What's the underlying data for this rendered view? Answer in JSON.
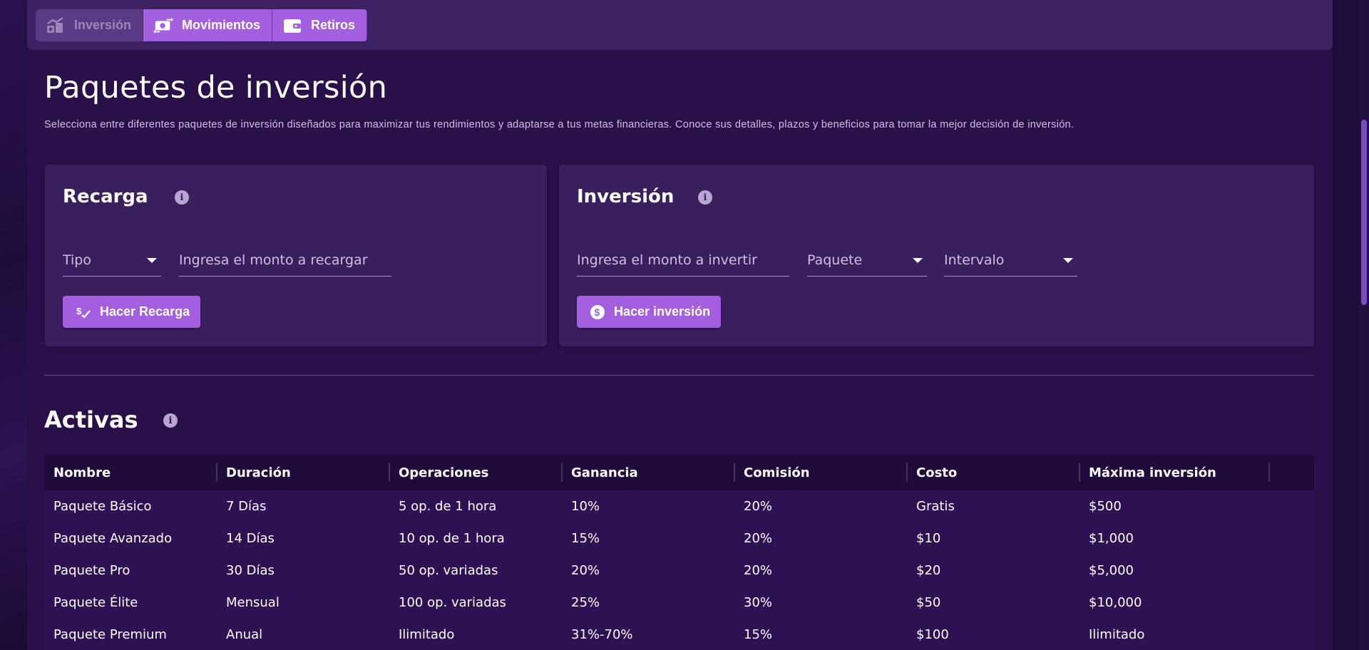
{
  "nav": {
    "tabs": [
      {
        "label": "Inversión",
        "icon": "growth-chart-icon",
        "state": "disabled"
      },
      {
        "label": "Movimientos",
        "icon": "money-transfer-icon",
        "state": "active"
      },
      {
        "label": "Retiros",
        "icon": "wallet-icon",
        "state": "active"
      }
    ]
  },
  "page": {
    "title": "Paquetes de inversión",
    "description": "Selecciona entre diferentes paquetes de inversión diseñados para maximizar tus rendimientos y adaptarse a tus metas financieras. Conoce sus detalles, plazos y beneficios para tomar la mejor decisión de inversión."
  },
  "recarga": {
    "title": "Recarga",
    "type_field": "Tipo",
    "amount_field": "Ingresa el monto a recargar",
    "button": "Hacer Recarga"
  },
  "inversion": {
    "title": "Inversión",
    "amount_field": "Ingresa el monto a invertir",
    "package_field": "Paquete",
    "interval_field": "Intervalo",
    "button": "Hacer inversión"
  },
  "activas": {
    "title": "Activas",
    "columns": [
      "Nombre",
      "Duración",
      "Operaciones",
      "Ganancia",
      "Comisión",
      "Costo",
      "Máxima inversión"
    ],
    "rows": [
      [
        "Paquete Básico",
        "7 Días",
        "5 op. de 1 hora",
        "10%",
        "20%",
        "Gratis",
        "$500"
      ],
      [
        "Paquete Avanzado",
        "14 Días",
        "10 op. de 1 hora",
        "15%",
        "20%",
        "$10",
        "$1,000"
      ],
      [
        "Paquete Pro",
        "30 Días",
        "50 op. variadas",
        "20%",
        "20%",
        "$20",
        "$5,000"
      ],
      [
        "Paquete Élite",
        "Mensual",
        "100 op. variadas",
        "25%",
        "30%",
        "$50",
        "$10,000"
      ],
      [
        "Paquete Premium",
        "Anual",
        "Ilimitado",
        "31%-70%",
        "15%",
        "$100",
        "Ilimitado"
      ]
    ]
  },
  "colors": {
    "accent": "#a35fe0",
    "background": "#2a1049",
    "card": "#3a1f5f",
    "table_header": "#1f0a3c"
  }
}
